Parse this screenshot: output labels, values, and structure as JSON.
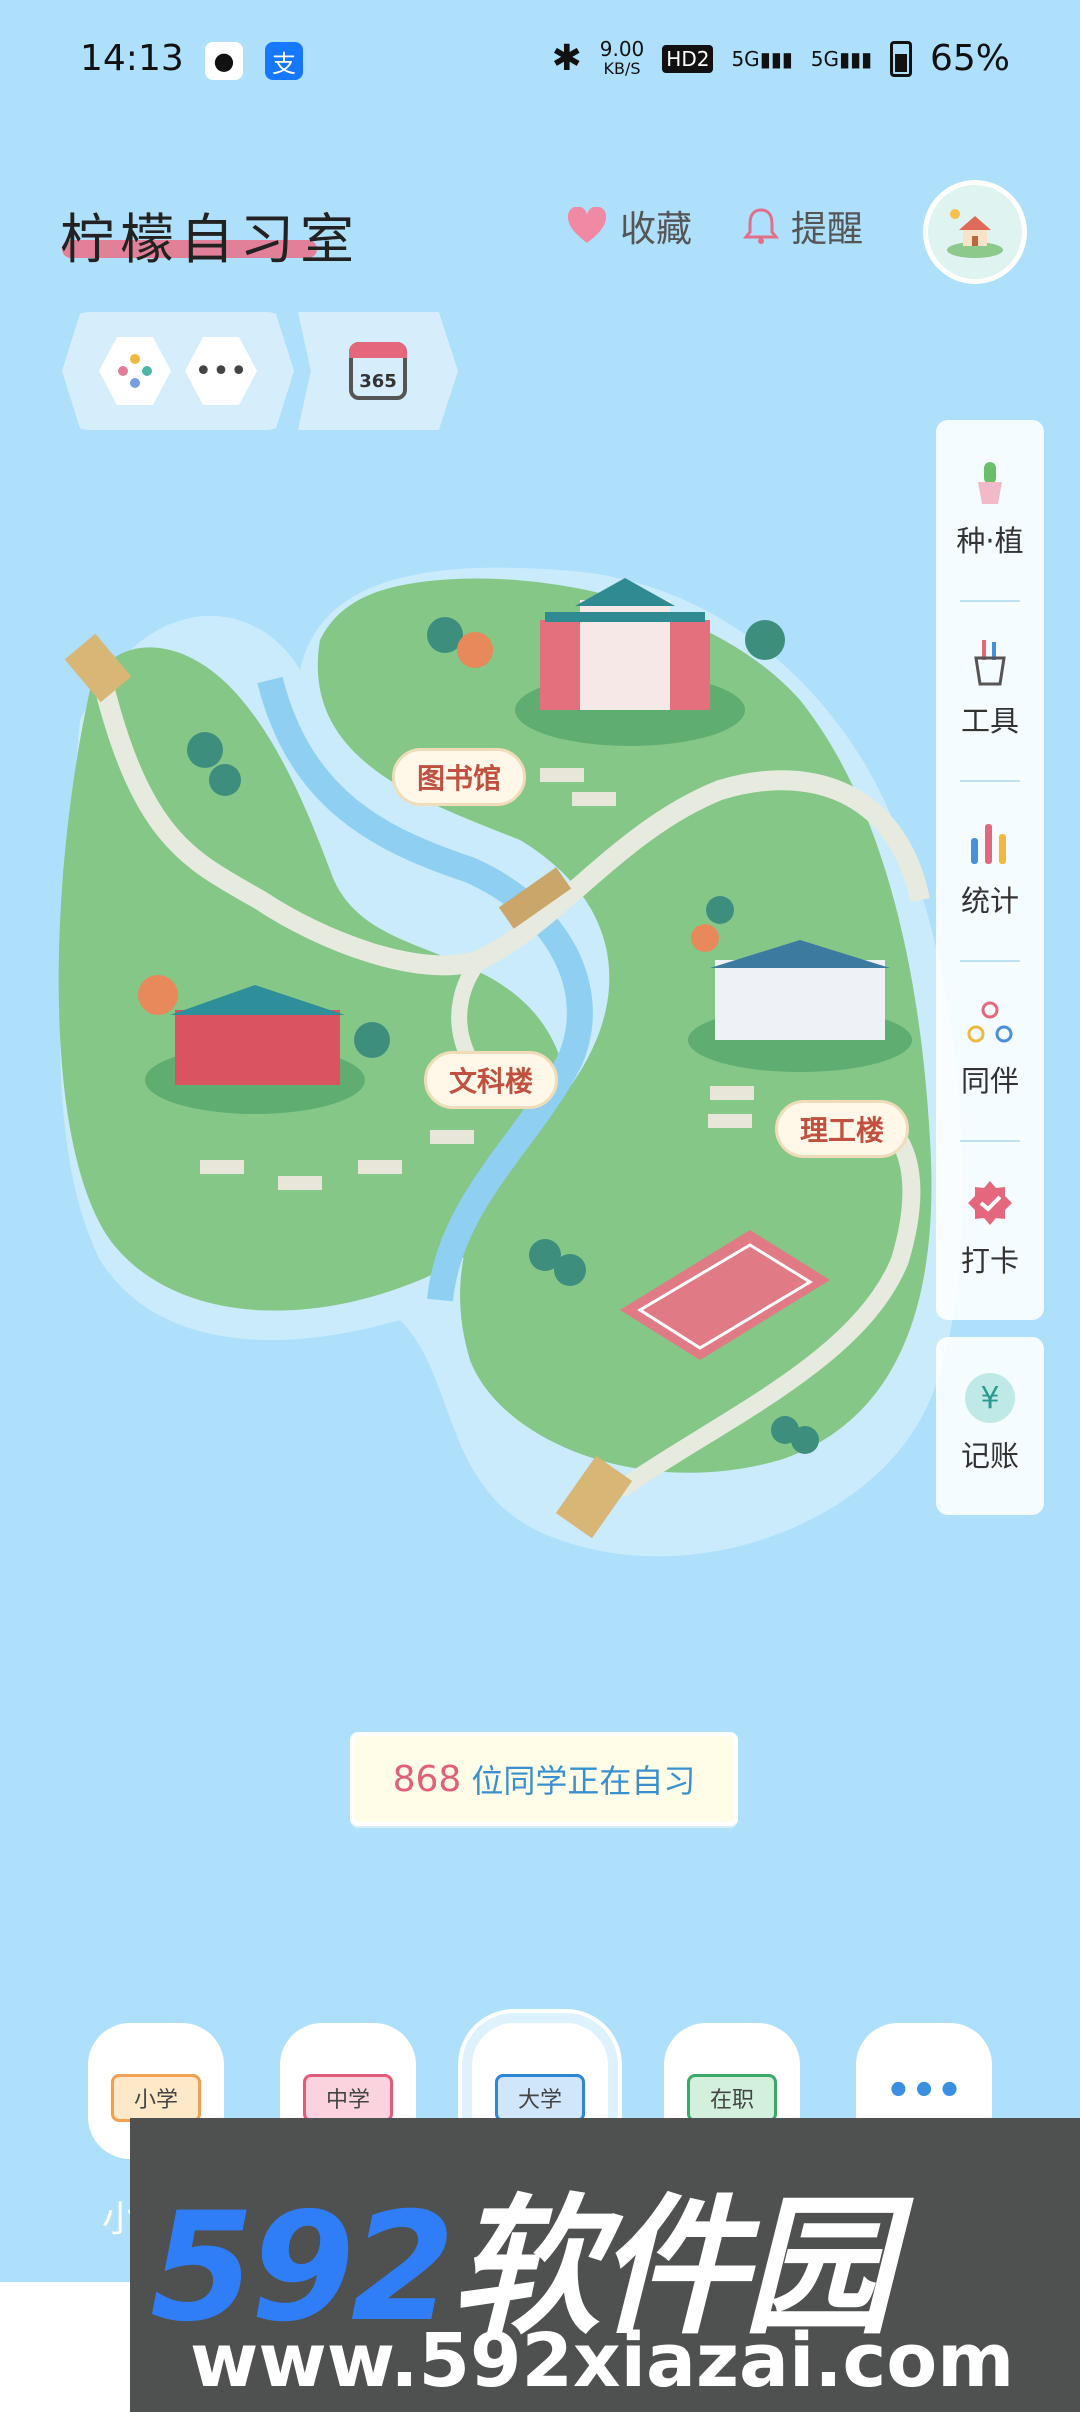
{
  "status": {
    "time": "14:13",
    "net_speed": "9.00",
    "net_unit": "KB/S",
    "hd": "HD2",
    "sig1": "5G",
    "sig2": "5G",
    "battery": "65%"
  },
  "header": {
    "title": "柠檬自习室",
    "favorites": "收藏",
    "reminder": "提醒"
  },
  "tools": {
    "calendar_badge": "365"
  },
  "side_menu": [
    {
      "label": "种·植",
      "icon": "cactus-plant-icon"
    },
    {
      "label": "工具",
      "icon": "pencil-cup-icon"
    },
    {
      "label": "统计",
      "icon": "bar-stats-icon"
    },
    {
      "label": "同伴",
      "icon": "companions-icon"
    },
    {
      "label": "打卡",
      "icon": "checkin-badge-icon"
    }
  ],
  "side_menu_extra": {
    "label": "记账",
    "symbol": "¥"
  },
  "map": {
    "library": "图书馆",
    "arts_building": "文科楼",
    "science_building": "理工楼"
  },
  "banner": {
    "count": "868",
    "text": "位同学正在自习"
  },
  "levels": [
    {
      "label": "小学",
      "color": "#f0a050"
    },
    {
      "label": "中学",
      "color": "#e45b7a"
    },
    {
      "label": "大学",
      "color": "#2f86d6"
    },
    {
      "label": "在职",
      "color": "#3aa867"
    },
    {
      "label": "•••",
      "color": "#3b8fe0"
    }
  ],
  "level_caption_partial": "小",
  "watermark": {
    "digits": "592",
    "brand": "软件园",
    "url": "www.592xiazai.com"
  }
}
